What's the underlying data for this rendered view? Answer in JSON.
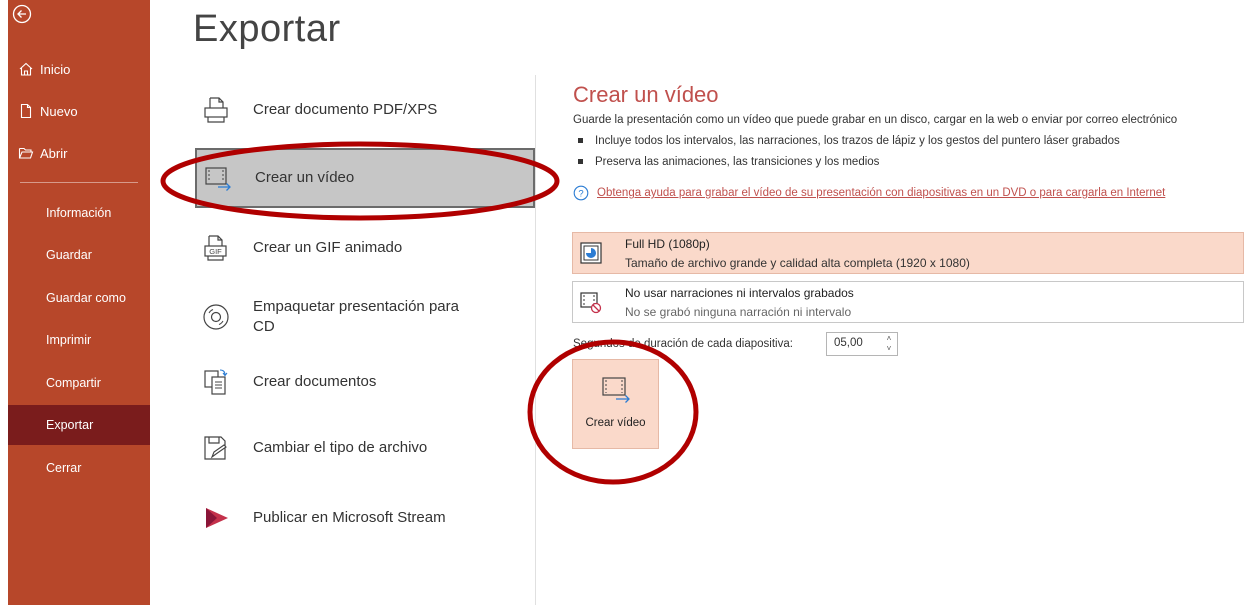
{
  "sidebar": {
    "top_items": [
      {
        "label": "Inicio",
        "icon": "home-icon"
      },
      {
        "label": "Nuevo",
        "icon": "new-document-icon"
      },
      {
        "label": "Abrir",
        "icon": "folder-open-icon"
      }
    ],
    "items": [
      {
        "label": "Información"
      },
      {
        "label": "Guardar"
      },
      {
        "label": "Guardar como"
      },
      {
        "label": "Imprimir"
      },
      {
        "label": "Compartir"
      },
      {
        "label": "Exportar",
        "active": true
      },
      {
        "label": "Cerrar"
      }
    ]
  },
  "page": {
    "title": "Exportar"
  },
  "options": [
    {
      "label": "Crear documento PDF/XPS",
      "icon": "pdf-document-icon"
    },
    {
      "label": "Crear un vídeo",
      "icon": "video-icon",
      "selected": true
    },
    {
      "label": "Crear un GIF animado",
      "icon": "gif-icon"
    },
    {
      "label": "Empaquetar presentación para CD",
      "icon": "cd-icon"
    },
    {
      "label": "Crear documentos",
      "icon": "handouts-icon"
    },
    {
      "label": "Cambiar el tipo de archivo",
      "icon": "change-file-type-icon"
    },
    {
      "label": "Publicar en Microsoft Stream",
      "icon": "stream-icon"
    }
  ],
  "detail": {
    "title": "Crear un vídeo",
    "description": "Guarde la presentación como un vídeo que puede grabar en un disco, cargar en la web o enviar por correo electrónico",
    "bullets": [
      "Incluye todos los intervalos, las narraciones, los trazos de lápiz y los gestos del puntero láser grabados",
      "Preserva las animaciones, las transiciones y los medios"
    ],
    "help_link": "Obtenga ayuda para grabar el vídeo de su presentación con diapositivas en un DVD o para cargarla en Internet",
    "quality": {
      "title": "Full HD (1080p)",
      "subtitle": "Tamaño de archivo grande y calidad alta completa (1920 x 1080)"
    },
    "narration": {
      "title": "No usar narraciones ni intervalos grabados",
      "subtitle": "No se grabó ninguna narración ni intervalo"
    },
    "seconds_label": "Segundos de duración de cada diapositiva:",
    "seconds_value": "05,00",
    "create_button": "Crear vídeo"
  },
  "colors": {
    "sidebar": "#b7472a",
    "sidebar_active": "#7a1c1c",
    "accent": "#c0504d",
    "highlight": "#fad9ca",
    "annotation": "#b00000"
  }
}
